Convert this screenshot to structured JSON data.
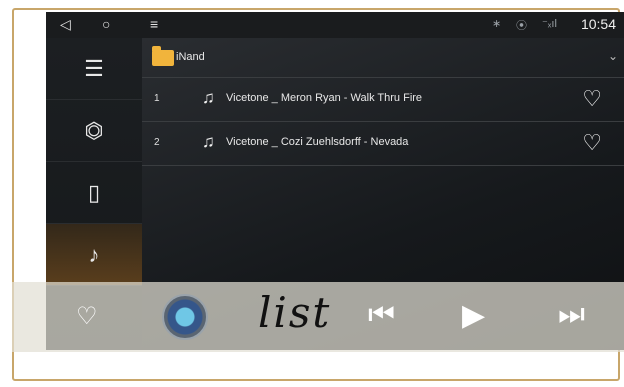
{
  "status_bar": {
    "nav_back": "◁",
    "nav_home": "○",
    "nav_menu": "≡",
    "bluetooth": "∗",
    "location": "⦿",
    "signal": "⁻ₓıl",
    "time": "10:54"
  },
  "sidebar": {
    "items": [
      {
        "icon": "list-icon",
        "glyph": "☰"
      },
      {
        "icon": "usb-icon",
        "glyph": "⏣"
      },
      {
        "icon": "sd-card-icon",
        "glyph": "▯"
      },
      {
        "icon": "music-folder-icon",
        "glyph": "♪",
        "active": true
      },
      {
        "icon": "heart-icon",
        "glyph": "♡"
      }
    ]
  },
  "main": {
    "path_label": "iNand",
    "tracks": [
      {
        "number": "1",
        "title": "Vicetone _ Meron Ryan - Walk Thru Fire"
      },
      {
        "number": "2",
        "title": "Vicetone _ Cozi Zuehlsdorff - Nevada"
      }
    ]
  },
  "player": {
    "overlay_word": "list",
    "prev": "⏮",
    "play": "▶",
    "next": "⏭",
    "heart": "♡"
  },
  "colors": {
    "accent_gold": "#c8a66a",
    "active_tab": "#5a3e1c",
    "folder": "#f1b43c"
  }
}
